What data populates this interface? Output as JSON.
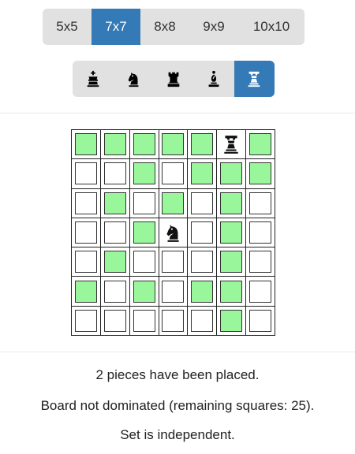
{
  "board_sizes": {
    "options": [
      "5x5",
      "7x7",
      "8x8",
      "9x9",
      "10x10"
    ],
    "selected": "7x7"
  },
  "piece_types": {
    "options": [
      "king",
      "knight",
      "rook",
      "bishop",
      "queen"
    ],
    "selected": "queen"
  },
  "board": {
    "size": 7,
    "pieces": [
      {
        "row": 0,
        "col": 5,
        "type": "queen"
      },
      {
        "row": 3,
        "col": 3,
        "type": "knight"
      }
    ],
    "dominated": [
      [
        1,
        1,
        1,
        1,
        1,
        0,
        1
      ],
      [
        0,
        0,
        1,
        0,
        1,
        1,
        1
      ],
      [
        0,
        1,
        0,
        1,
        0,
        1,
        0
      ],
      [
        0,
        0,
        1,
        0,
        0,
        1,
        0
      ],
      [
        0,
        1,
        0,
        0,
        0,
        1,
        0
      ],
      [
        1,
        0,
        1,
        0,
        1,
        1,
        0
      ],
      [
        0,
        0,
        0,
        0,
        0,
        1,
        0
      ]
    ],
    "colors": {
      "dominated": "#99f69a",
      "empty": "#ffffff",
      "active_button": "#337ab7"
    }
  },
  "status": {
    "placed": "2 pieces have been placed.",
    "domination": "Board not dominated (remaining squares: 25).",
    "independence": "Set is independent."
  }
}
